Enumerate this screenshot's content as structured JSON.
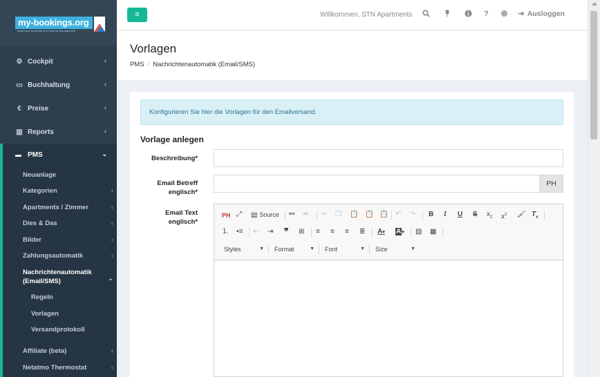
{
  "brand": {
    "name": "my-bookings.org",
    "tagline": "Apartment Bookings and Channel Management"
  },
  "sidebar": {
    "items": [
      {
        "label": "Cockpit",
        "icon": "dashboard-icon",
        "glyph": "⚙"
      },
      {
        "label": "Buchhaltung",
        "icon": "folder-icon",
        "glyph": "▭"
      },
      {
        "label": "Preise",
        "icon": "euro-icon",
        "glyph": "€"
      },
      {
        "label": "Reports",
        "icon": "bar-chart-icon",
        "glyph": "▥"
      }
    ],
    "pms": {
      "label": "PMS",
      "icon": "bed-icon",
      "children": [
        {
          "label": "Neuanlage"
        },
        {
          "label": "Kategorien"
        },
        {
          "label": "Apartments / Zimmer"
        },
        {
          "label": "Dies & Das"
        },
        {
          "label": "Bilder"
        },
        {
          "label": "Zahlungsautomatik"
        },
        {
          "label_line1": "Nachrichtenautomatik",
          "label_line2": "(Email/SMS)"
        },
        {
          "label": "Affiliate (beta)"
        },
        {
          "label": "Netatmo Thermostat"
        }
      ],
      "nachrichten_children": [
        {
          "label": "Regeln"
        },
        {
          "label": "Vorlagen"
        },
        {
          "label": "Versandprotokoll"
        }
      ]
    }
  },
  "topbar": {
    "welcome": "Willkommen, STN Apartments",
    "logout": "Ausloggen"
  },
  "page": {
    "title": "Vorlagen",
    "breadcrumb": [
      "PMS",
      "Nachrichtenautomatik (Email/SMS)"
    ]
  },
  "alert": "Konfigurieren Sie hier die Vorlagen für den Emailversand.",
  "form": {
    "section_title": "Vorlage anlegen",
    "description_label": "Beschreibung*",
    "subject_label_line1": "Email Betreff",
    "subject_label_line2": "englisch*",
    "subject_addon": "PH",
    "body_label_line1": "Email Text",
    "body_label_line2": "englisch*"
  },
  "editor": {
    "ph_button": "PH",
    "source_label": "Source",
    "styles_label": "Styles",
    "format_label": "Format",
    "font_label": "Font",
    "size_label": "Size"
  },
  "colors": {
    "accent": "#17b794",
    "sidebar": "#2d3e4e",
    "alert_bg": "#d9f0f7",
    "alert_text": "#31708f"
  }
}
